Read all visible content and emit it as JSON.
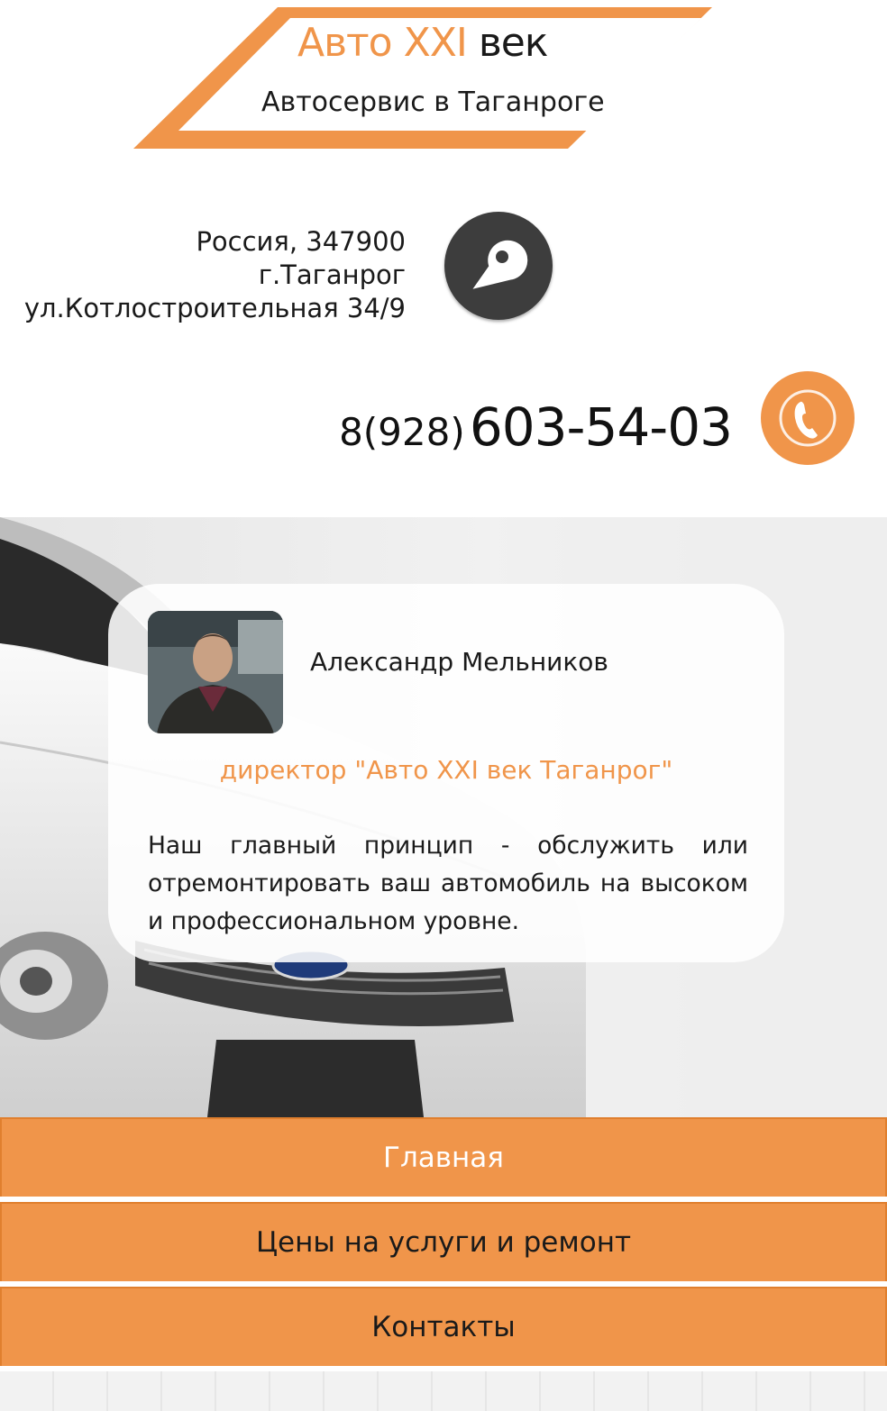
{
  "logo": {
    "brand": "Авто XXI",
    "rest": "век",
    "subtitle": "Автосервис в Таганроге"
  },
  "address": {
    "line1": "Россия, 347900",
    "line2": "г.Таганрог",
    "line3": "ул.Котлостроительная 34/9",
    "icon": "map-pin-icon"
  },
  "phone": {
    "code": "8(928)",
    "number": "603-54-03",
    "icon": "phone-icon"
  },
  "testimonial": {
    "name": "Александр Мельников",
    "role": "директор \"Авто XXI век Таганрог\"",
    "text": "Наш главный принцип - обслужить или отремонтировать ваш автомобиль на высоком и профессиональном уровне."
  },
  "nav": {
    "items": [
      {
        "label": "Главная",
        "active": true
      },
      {
        "label": "Цены на услуги и ремонт",
        "active": false
      },
      {
        "label": "Контакты",
        "active": false
      }
    ]
  },
  "colors": {
    "accent": "#f0954a",
    "dark_icon": "#3d3d3d"
  }
}
